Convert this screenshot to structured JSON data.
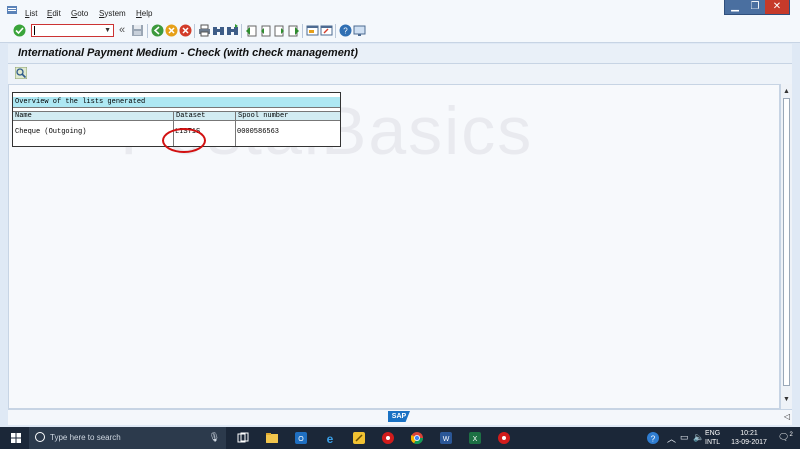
{
  "menu": {
    "items": [
      {
        "label": "List",
        "underline": "L",
        "rest": "ist"
      },
      {
        "label": "Edit",
        "underline": "E",
        "rest": "dit"
      },
      {
        "label": "Goto",
        "underline": "G",
        "rest": "oto"
      },
      {
        "label": "System",
        "underline": "S",
        "rest": "ystem"
      },
      {
        "label": "Help",
        "underline": "H",
        "rest": "elp"
      }
    ]
  },
  "window_controls": {
    "minimize": "▁",
    "restore": "❐",
    "close": "✕"
  },
  "toolbar": {
    "command_value": "",
    "icons": [
      "enter-check-icon",
      "back-double-arrow-icon",
      "save-icon",
      "back-icon",
      "exit-icon",
      "cancel-icon",
      "print-icon",
      "find-icon",
      "find-next-icon",
      "first-page-icon",
      "previous-page-icon",
      "next-page-icon",
      "last-page-icon",
      "create-session-icon",
      "shortcut-icon",
      "help-icon",
      "customize-layout-icon"
    ]
  },
  "title": {
    "text": "International Payment Medium - Check (with check management)"
  },
  "app_toolbar": {
    "icons": [
      "zoom-detail-icon"
    ]
  },
  "watermark": {
    "text": "PostalBasics"
  },
  "lists_table": {
    "caption": "Overview of the lists generated",
    "headers": [
      "Name",
      "Dataset",
      "Spool number"
    ],
    "rows": [
      [
        "Cheque (Outgoing)",
        "LIST1S",
        "0000586563"
      ]
    ]
  },
  "status_bar": {
    "logo_text": "SAP"
  },
  "taskbar": {
    "search_placeholder": "Type here to search",
    "lang_line1": "ENG",
    "lang_line2": "INTL",
    "time": "10:21",
    "date": "13-09-2017",
    "notification_count": "2",
    "apps": [
      "task-view-icon",
      "file-explorer-icon",
      "outlook-icon",
      "edge-icon",
      "sap-logon-icon",
      "sap-gui-icon",
      "chrome-icon",
      "word-icon",
      "excel-icon",
      "sap-gui-icon-2"
    ]
  },
  "colors": {
    "accent": "#1a72c4",
    "table_caption": "#aee8f3",
    "table_header": "#d2ecf2",
    "annotation": "#d21010"
  }
}
